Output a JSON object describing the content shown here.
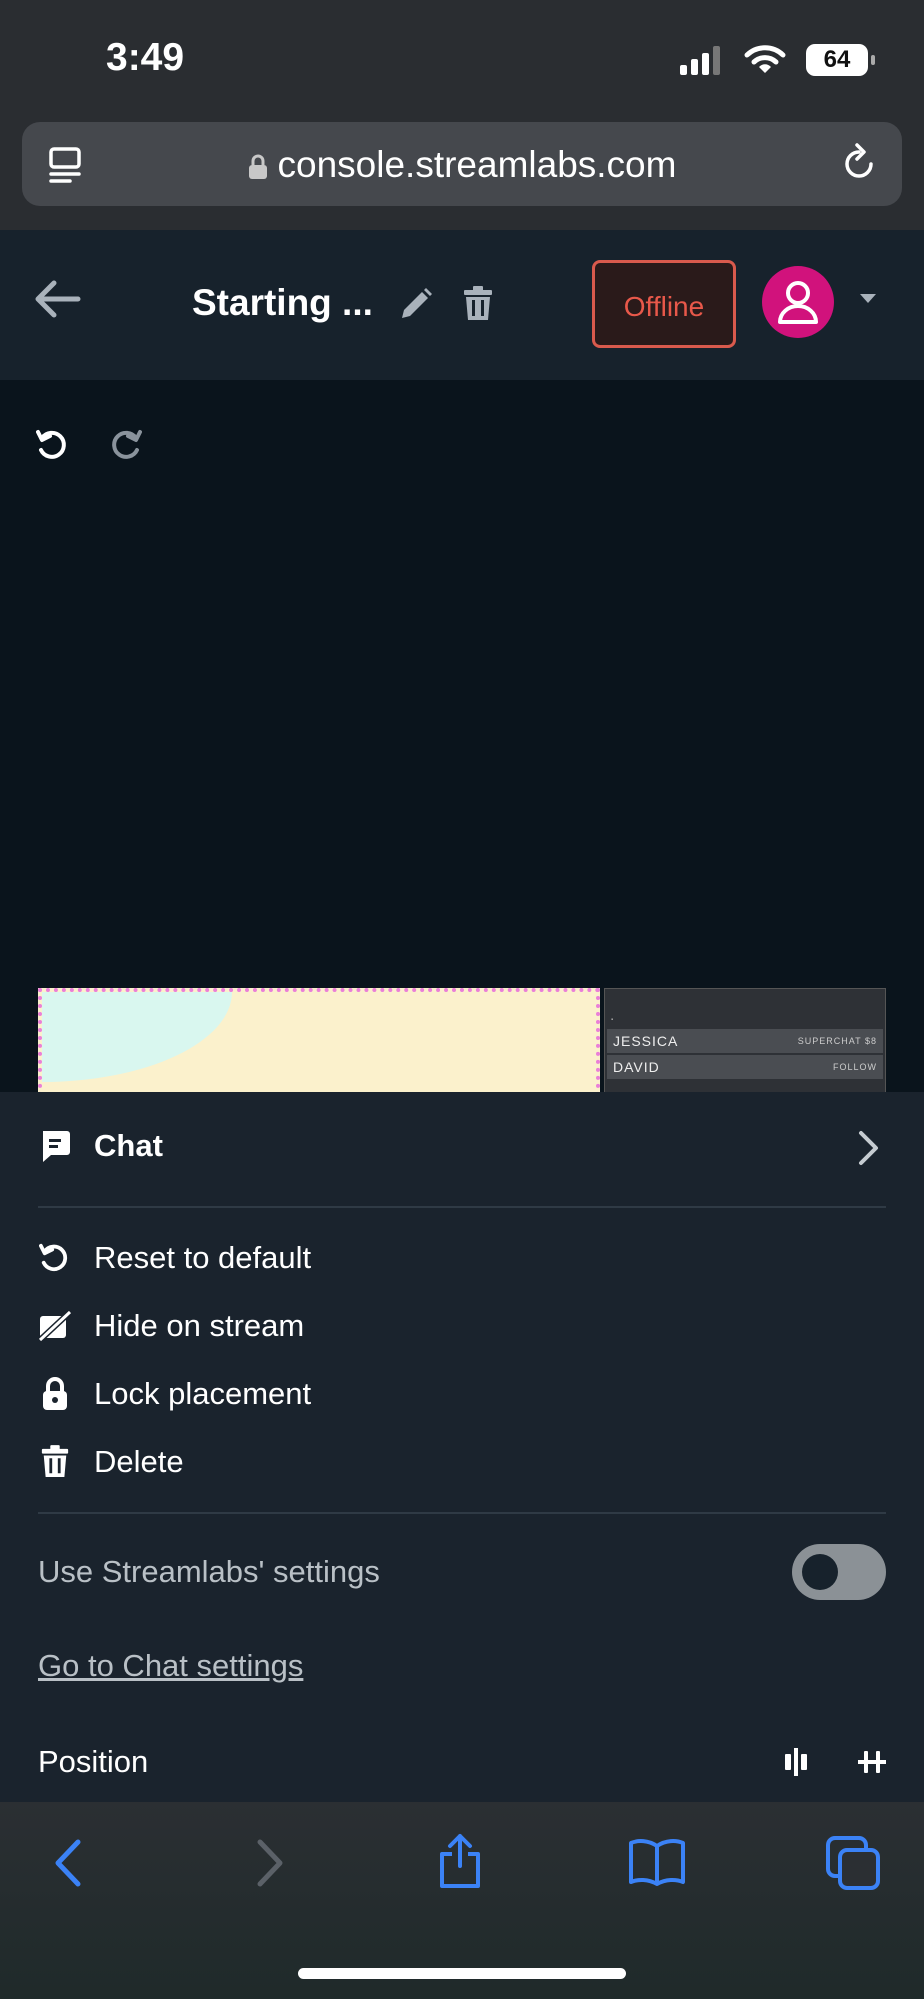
{
  "status_bar": {
    "time": "3:49",
    "battery": "64"
  },
  "browser": {
    "url": "console.streamlabs.com"
  },
  "header": {
    "scene_title": "Starting ...",
    "status_button": "Offline"
  },
  "preview": {
    "event_feed": [
      {
        "name": "JESSICA",
        "event": "SUPERCHAT $8"
      },
      {
        "name": "DAVID",
        "event": "FOLLOW"
      }
    ]
  },
  "sheet": {
    "title": "Chat",
    "actions": [
      "Reset to default",
      "Hide on stream",
      "Lock placement",
      "Delete"
    ],
    "use_settings_label": "Use Streamlabs' settings",
    "use_settings_enabled": false,
    "settings_link": "Go to Chat settings",
    "position_label": "Position"
  },
  "colors": {
    "accent_pink": "#d1127c",
    "offline_red": "#e8584a",
    "safari_blue": "#3b82f6"
  },
  "icons": [
    "reader-icon",
    "lock-icon",
    "reload-icon",
    "back-arrow-icon",
    "pencil-icon",
    "trash-icon",
    "user-icon",
    "caret-down-icon",
    "undo-icon",
    "redo-icon",
    "chat-icon",
    "chevron-right-icon",
    "reset-icon",
    "hide-icon",
    "padlock-icon",
    "delete-icon",
    "align-vertical-icon",
    "align-horizontal-icon",
    "safari-back-icon",
    "safari-forward-icon",
    "share-icon",
    "bookmarks-icon",
    "tabs-icon"
  ]
}
